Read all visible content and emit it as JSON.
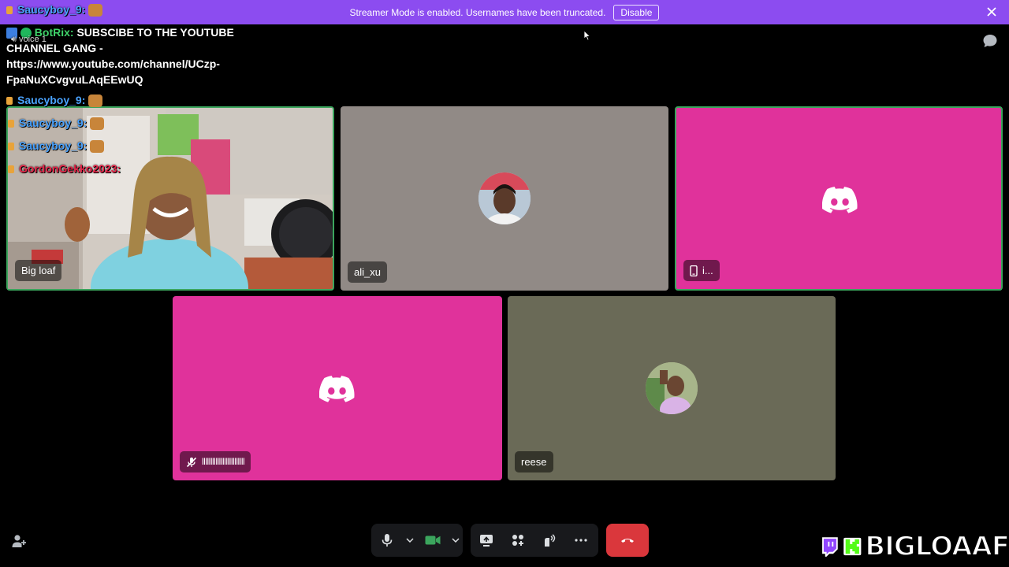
{
  "banner": {
    "text": "Streamer Mode is enabled. Usernames have been truncated.",
    "button_label": "Disable"
  },
  "chat_overlay": {
    "top_line": {
      "user": "Saucyboy_9:"
    },
    "bot_message": {
      "user": "BotRix:",
      "line1": "SUBSCIBE TO THE YOUTUBE",
      "line2": "CHANNEL GANG -",
      "line3": "https://www.youtube.com/channel/UCzp-",
      "line4": "FpaNuXCvgvuLAqEEwUQ"
    },
    "voice_channel": "voice 1",
    "lines": [
      {
        "user": "Saucyboy_9:"
      },
      {
        "user": "Saucyboy_9:"
      },
      {
        "user": "Saucyboy_9:"
      },
      {
        "user": "GordonGekko2023:"
      }
    ]
  },
  "tiles": [
    {
      "name": "Big loaf",
      "kind": "video"
    },
    {
      "name": "ali_xu",
      "kind": "avatar",
      "bg": "#918a86"
    },
    {
      "name": "i...",
      "kind": "discord",
      "bg": "#e0329b"
    },
    {
      "name": "lllllllllllllllllllllllll",
      "kind": "discord",
      "bg": "#e0329b",
      "muted": true
    },
    {
      "name": "reese",
      "kind": "avatar",
      "bg": "#6a6a57"
    }
  ],
  "colors": {
    "banner": "#8c4cf0",
    "discord_pink": "#e0329b",
    "speaking_border": "#3ba55d",
    "hangup": "#da373c"
  },
  "logo": {
    "text": "BIGLOAAF"
  }
}
